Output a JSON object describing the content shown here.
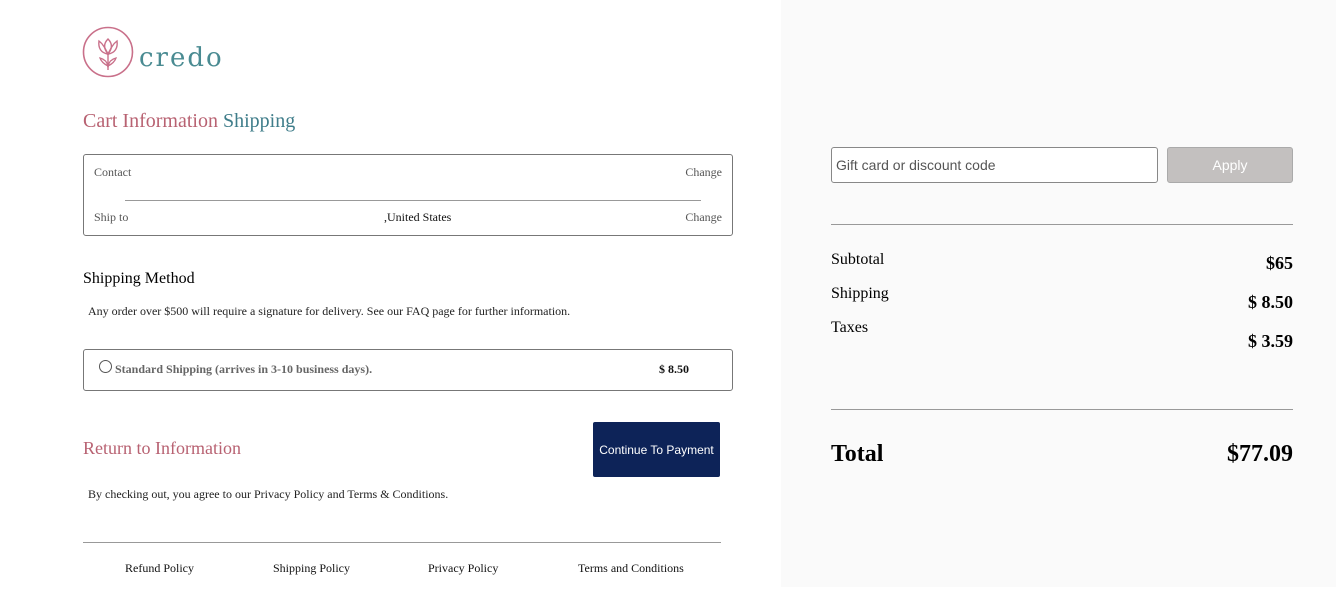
{
  "brand": {
    "name": "credo",
    "primary_color": "#b86272",
    "secondary_color": "#4a8b92",
    "icon": "tulip-logo-icon"
  },
  "breadcrumb": {
    "cart_information": "Cart Information",
    "shipping": "Shipping"
  },
  "info": {
    "contact_label": "Contact",
    "contact_change": "Change",
    "ship_to_label": "Ship to",
    "ship_to_value": ",United States",
    "ship_to_change": "Change"
  },
  "shipping_method": {
    "title": "Shipping Method",
    "note": "Any order over $500 will require a signature for delivery. See our FAQ page for further information.",
    "rate_label": "Standard Shipping (arrives in 3-10 business days).",
    "rate_price": "$ 8.50"
  },
  "actions": {
    "return_link": "Return to Information",
    "continue_button": "Continue To Payment",
    "button_color": "#0d2358"
  },
  "agreement": "By checking out, you agree to our Privacy Policy and Terms & Conditions.",
  "footer": {
    "refund_policy": "Refund Policy",
    "shipping_policy": "Shipping Policy",
    "privacy_policy": "Privacy Policy",
    "terms": "Terms and Conditions"
  },
  "summary": {
    "discount_placeholder": "Gift card or discount code",
    "apply_label": "Apply",
    "subtotal_label": "Subtotal",
    "subtotal_value": "$65",
    "shipping_label": "Shipping",
    "shipping_value": "$ 8.50",
    "taxes_label": "Taxes",
    "taxes_value": "$ 3.59",
    "total_label": "Total",
    "total_value": "$77.09"
  }
}
